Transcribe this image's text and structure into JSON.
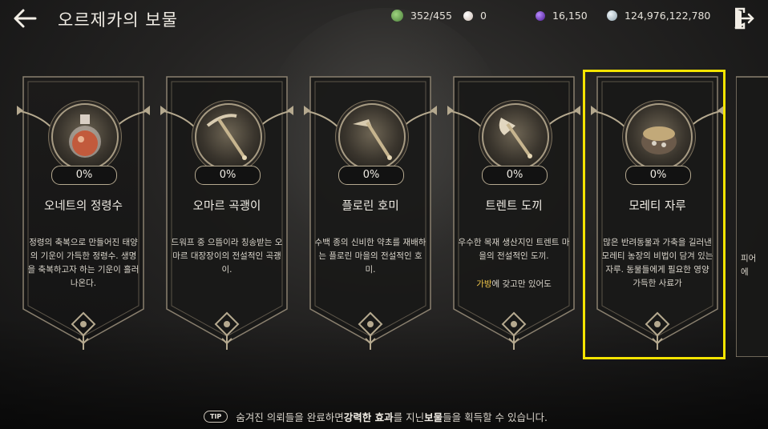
{
  "header": {
    "title": "오르제카의 보물",
    "resources": [
      {
        "icon": "leaf-token-icon",
        "value": "352/455",
        "color": "#6aa35a"
      },
      {
        "icon": "pearl-icon",
        "value": "0",
        "color": "#e9ddd6"
      },
      {
        "icon": "purple-orb-icon",
        "value": "16,150",
        "color": "#6b2fb8"
      },
      {
        "icon": "silver-coin-icon",
        "value": "124,976,122,780",
        "color": "#b9c6cf"
      }
    ]
  },
  "cards": [
    {
      "name": "오네트의 정령수",
      "percent": "0%",
      "icon": "potion-flask-icon",
      "desc": "정령의 축복으로 만들어진 태양의 기운이 가득한 정령수. 생명을 축복하고자 하는 기운이 흘러나온다."
    },
    {
      "name": "오마르 곡괭이",
      "percent": "0%",
      "icon": "pickaxe-icon",
      "desc": "드워프 중 으뜸이라 칭송받는 오마르 대장장이의 전설적인 곡괭이."
    },
    {
      "name": "플로린 호미",
      "percent": "0%",
      "icon": "hoe-icon",
      "desc": "수백 종의 신비한 약초를 재배하는 플로린 마을의 전설적인 호미."
    },
    {
      "name": "트렌트 도끼",
      "percent": "0%",
      "icon": "axe-icon",
      "desc": "우수한 목재 생산지인 트렌트 마을의 전설적인 도끼.",
      "extra_highlight": "가방",
      "extra_rest": "에 갖고만 있어도"
    },
    {
      "name": "모레티 자루",
      "percent": "0%",
      "icon": "feed-sack-icon",
      "desc": "많은 반려동물과 가축을 길러낸 모레티 농장의 비법이 담겨 있는 자루. 동물들에게 필요한 영양 가득한 사료가"
    }
  ],
  "partial_card": {
    "text_line1": "피어",
    "text_line2": "에"
  },
  "tip": {
    "badge": "TIP",
    "text_a": "숨겨진 의뢰들을 완료하면 ",
    "bold_a": "강력한 효과",
    "text_b": "를 지닌 ",
    "bold_b": "보물",
    "text_c": "들을 획득할 수 있습니다."
  }
}
